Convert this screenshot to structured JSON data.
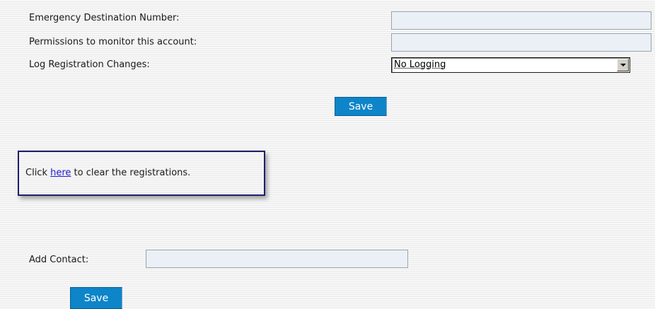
{
  "fields": {
    "emergency_label": "Emergency Destination Number:",
    "emergency_value": "",
    "permissions_label": "Permissions to monitor this account:",
    "permissions_value": "",
    "log_label": "Log Registration Changes:",
    "log_selected": "No Logging"
  },
  "save_button_top": "Save",
  "notice": {
    "prefix": "Click ",
    "link": "here",
    "suffix": " to clear the registrations."
  },
  "contact": {
    "label": "Add Contact:",
    "value": ""
  },
  "save_button_bottom": "Save",
  "icons": {
    "select_arrow": "chevron-down-icon"
  }
}
